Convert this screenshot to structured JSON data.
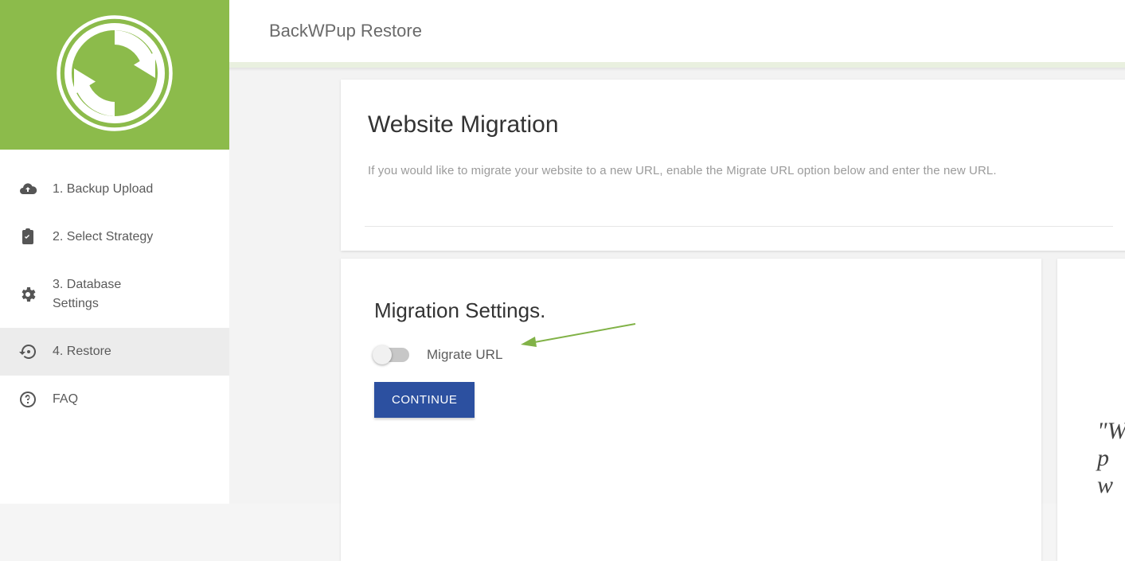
{
  "header": {
    "title": "BackWPup Restore"
  },
  "sidebar": {
    "items": [
      {
        "label": "1. Backup Upload"
      },
      {
        "label": "2. Select Strategy"
      },
      {
        "label": "3. Database Settings"
      },
      {
        "label": "4. Restore"
      },
      {
        "label": "FAQ"
      }
    ]
  },
  "card_intro": {
    "heading": "Website Migration",
    "body": "If you would like to migrate your website to a new URL, enable the Migrate URL option below and enter the new URL."
  },
  "card_settings": {
    "heading": "Migration Settings.",
    "toggle_label": "Migrate URL",
    "toggle_on": false,
    "continue_label": "CONTINUE"
  },
  "card_quote": {
    "text_fragment": "\"W\np\nw"
  },
  "colors": {
    "brand_green": "#8cbb4b",
    "primary_blue": "#2c50a0",
    "annot_green": "#81b247"
  }
}
